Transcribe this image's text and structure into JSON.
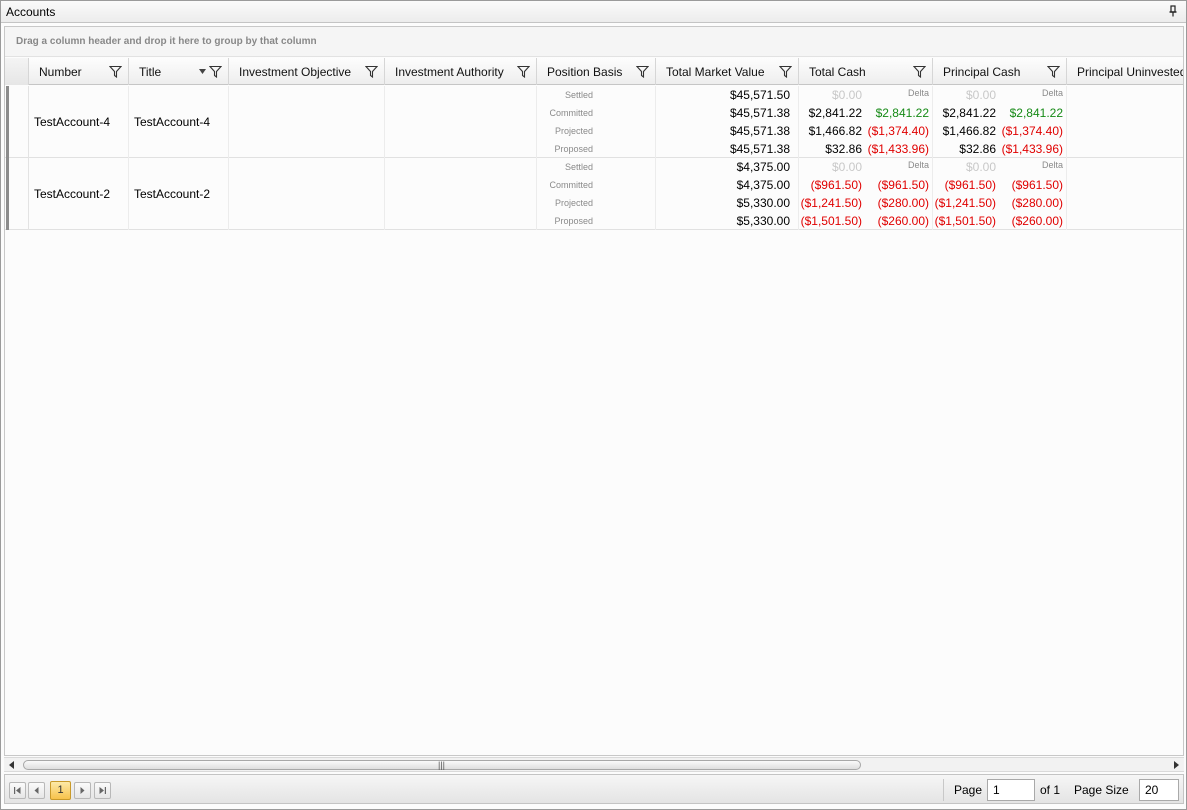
{
  "window": {
    "title": "Accounts"
  },
  "group_panel": {
    "hint": "Drag a column header and drop it here to group by that column"
  },
  "columns": [
    {
      "label": "Number"
    },
    {
      "label": "Title"
    },
    {
      "label": "Investment Objective"
    },
    {
      "label": "Investment Authority"
    },
    {
      "label": "Position Basis"
    },
    {
      "label": "Total Market Value"
    },
    {
      "label": "Total Cash"
    },
    {
      "label": "Principal Cash"
    },
    {
      "label": "Principal Uninvested"
    }
  ],
  "rows": [
    {
      "number": "TestAccount-4",
      "title": "TestAccount-4",
      "objective": "",
      "authority": "",
      "subrows": [
        {
          "basis": "Settled",
          "tmv": "$45,571.50",
          "tc": "$0.00",
          "tc_delta": "Delta",
          "pc": "$0.00",
          "pc_delta": "Delta"
        },
        {
          "basis": "Committed",
          "tmv": "$45,571.38",
          "tc": "$2,841.22",
          "tc_delta": "$2,841.22",
          "pc": "$2,841.22",
          "pc_delta": "$2,841.22"
        },
        {
          "basis": "Projected",
          "tmv": "$45,571.38",
          "tc": "$1,466.82",
          "tc_delta": "($1,374.40)",
          "pc": "$1,466.82",
          "pc_delta": "($1,374.40)"
        },
        {
          "basis": "Proposed",
          "tmv": "$45,571.38",
          "tc": "$32.86",
          "tc_delta": "($1,433.96)",
          "pc": "$32.86",
          "pc_delta": "($1,433.96)"
        }
      ]
    },
    {
      "number": "TestAccount-2",
      "title": "TestAccount-2",
      "objective": "",
      "authority": "",
      "subrows": [
        {
          "basis": "Settled",
          "tmv": "$4,375.00",
          "tc": "$0.00",
          "tc_delta": "Delta",
          "pc": "$0.00",
          "pc_delta": "Delta"
        },
        {
          "basis": "Committed",
          "tmv": "$4,375.00",
          "tc": "($961.50)",
          "tc_delta": "($961.50)",
          "pc": "($961.50)",
          "pc_delta": "($961.50)"
        },
        {
          "basis": "Projected",
          "tmv": "$5,330.00",
          "tc": "($1,241.50)",
          "tc_delta": "($280.00)",
          "pc": "($1,241.50)",
          "pc_delta": "($280.00)"
        },
        {
          "basis": "Proposed",
          "tmv": "$5,330.00",
          "tc": "($1,501.50)",
          "tc_delta": "($260.00)",
          "pc": "($1,501.50)",
          "pc_delta": "($260.00)"
        }
      ]
    }
  ],
  "pager": {
    "current_page": "1",
    "page_label": "Page",
    "page_value": "1",
    "of_label": "of 1",
    "size_label": "Page Size",
    "size_value": "20"
  },
  "colors": {
    "negative": "#e00000",
    "positive": "#168a16",
    "muted": "#c8c8c8",
    "pager_current": "#f7c24b"
  },
  "icons": [
    "pin-icon",
    "filter-icon",
    "sort-desc-icon",
    "first-page-icon",
    "prev-page-icon",
    "next-page-icon",
    "last-page-icon",
    "scroll-left-icon",
    "scroll-right-icon"
  ]
}
